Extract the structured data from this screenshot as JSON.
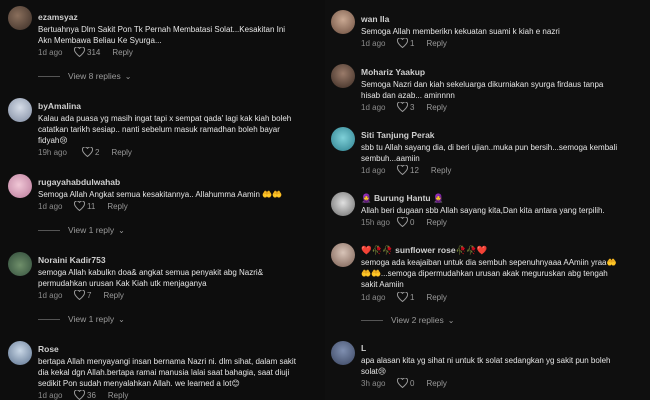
{
  "left": {
    "comments": [
      {
        "name": "ezamsyaz",
        "lines": [
          "Bertuahnya Dlm Sakit Pon Tk Pernah Membatasi Solat...Kesakitan Ini",
          "Akn Membawa Beliau Ke Syurga..."
        ],
        "date": "1d ago",
        "likes": "314",
        "reply": "Reply"
      },
      {
        "name": "byAmalina",
        "lines": [
          "Kalau ada puasa yg masih ingat tapi x sempat qada' lagi kak kiah boleh",
          "catatkan tarikh sesiap.. nanti sebelum masuk ramadhan boleh bayar",
          "fidyah😢"
        ],
        "date": "19h ago",
        "likes": "2",
        "reply": "Reply"
      },
      {
        "name": "rugayahabdulwahab",
        "lines": [
          "Semoga Allah Angkat semua kesakitannya.. Allahumma Aamin 🤲🤲"
        ],
        "date": "1d ago",
        "likes": "11",
        "reply": "Reply"
      },
      {
        "name": "Noraini Kadir753",
        "lines": [
          "semoga Allah kabulkn doa& angkat semua penyakit abg Nazri&",
          "permudahkan urusan Kak Kiah utk menjaganya"
        ],
        "date": "1d ago",
        "likes": "7",
        "reply": "Reply"
      },
      {
        "name": "Rose",
        "lines": [
          "bertapa Allah menyayangi insan bernama Nazri ni. dlm sihat, dalam sakit",
          "dia kekal dgn Allah.bertapa ramai manusia lalai saat bahagia, saat diuji",
          "sedikit Pon sudah menyalahkan Allah. we learned a lot😊"
        ],
        "date": "1d ago",
        "likes": "36",
        "reply": "Reply"
      }
    ],
    "views": [
      "View 8 replies",
      "View 1 reply",
      "View 1 reply"
    ]
  },
  "right": {
    "comments": [
      {
        "name": "wan Ila",
        "lines": [
          "Semoga Allah memberikn kekuatan suami k kiah e nazri"
        ],
        "date": "1d ago",
        "likes": "1",
        "reply": "Reply"
      },
      {
        "name": "Mohariz Yaakup",
        "lines": [
          "Semoga Nazri dan kiah sekeluarga dikurniakan syurga firdaus tanpa",
          "hisab dan azab... aminnnn"
        ],
        "date": "1d ago",
        "likes": "3",
        "reply": "Reply"
      },
      {
        "name": "Siti Tanjung Perak",
        "lines": [
          "sbb tu Allah sayang dia, di beri ujian..muka pun bersih...semoga kembali",
          "sembuh...aamiin"
        ],
        "date": "1d ago",
        "likes": "12",
        "reply": "Reply"
      },
      {
        "name": "🧕 Burung Hantu 🧕",
        "lines": [
          "Allah beri dugaan sbb Allah sayang kita,Dan kita antara yang terpilih."
        ],
        "date": "15h ago",
        "likes": "0",
        "reply": "Reply"
      },
      {
        "name": "❤️🥀🥀 sunflower rose🥀🥀❤️",
        "lines": [
          "semoga ada keajaiban untuk dia sembuh sepenuhnyaaa AAmiin yraa🤲",
          "🤲🤲...semoga dipermudahkan urusan akak meguruskan abg tengah",
          "sakit Aamiin"
        ],
        "date": "1d ago",
        "likes": "1",
        "reply": "Reply"
      },
      {
        "name": "L",
        "lines": [
          "apa alasan kita yg sihat ni untuk tk solat sedangkan yg sakit pun boleh",
          "solat😢"
        ],
        "date": "3h ago",
        "likes": "0",
        "reply": "Reply"
      }
    ],
    "views": [
      "View 2 replies"
    ]
  }
}
